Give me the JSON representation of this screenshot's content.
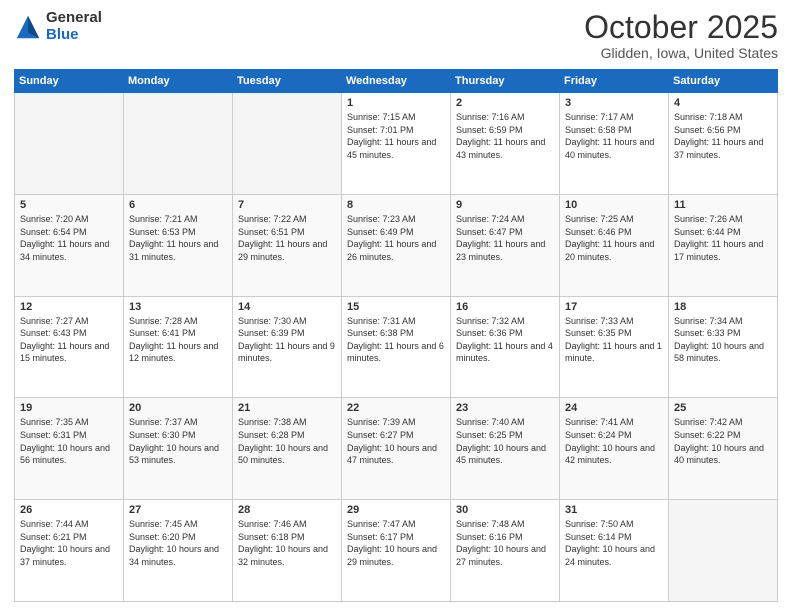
{
  "logo": {
    "general": "General",
    "blue": "Blue"
  },
  "title": "October 2025",
  "subtitle": "Glidden, Iowa, United States",
  "days_of_week": [
    "Sunday",
    "Monday",
    "Tuesday",
    "Wednesday",
    "Thursday",
    "Friday",
    "Saturday"
  ],
  "weeks": [
    [
      {
        "day": "",
        "empty": true
      },
      {
        "day": "",
        "empty": true
      },
      {
        "day": "",
        "empty": true
      },
      {
        "day": "1",
        "sunrise": "7:15 AM",
        "sunset": "7:01 PM",
        "daylight": "11 hours and 45 minutes."
      },
      {
        "day": "2",
        "sunrise": "7:16 AM",
        "sunset": "6:59 PM",
        "daylight": "11 hours and 43 minutes."
      },
      {
        "day": "3",
        "sunrise": "7:17 AM",
        "sunset": "6:58 PM",
        "daylight": "11 hours and 40 minutes."
      },
      {
        "day": "4",
        "sunrise": "7:18 AM",
        "sunset": "6:56 PM",
        "daylight": "11 hours and 37 minutes."
      }
    ],
    [
      {
        "day": "5",
        "sunrise": "7:20 AM",
        "sunset": "6:54 PM",
        "daylight": "11 hours and 34 minutes."
      },
      {
        "day": "6",
        "sunrise": "7:21 AM",
        "sunset": "6:53 PM",
        "daylight": "11 hours and 31 minutes."
      },
      {
        "day": "7",
        "sunrise": "7:22 AM",
        "sunset": "6:51 PM",
        "daylight": "11 hours and 29 minutes."
      },
      {
        "day": "8",
        "sunrise": "7:23 AM",
        "sunset": "6:49 PM",
        "daylight": "11 hours and 26 minutes."
      },
      {
        "day": "9",
        "sunrise": "7:24 AM",
        "sunset": "6:47 PM",
        "daylight": "11 hours and 23 minutes."
      },
      {
        "day": "10",
        "sunrise": "7:25 AM",
        "sunset": "6:46 PM",
        "daylight": "11 hours and 20 minutes."
      },
      {
        "day": "11",
        "sunrise": "7:26 AM",
        "sunset": "6:44 PM",
        "daylight": "11 hours and 17 minutes."
      }
    ],
    [
      {
        "day": "12",
        "sunrise": "7:27 AM",
        "sunset": "6:43 PM",
        "daylight": "11 hours and 15 minutes."
      },
      {
        "day": "13",
        "sunrise": "7:28 AM",
        "sunset": "6:41 PM",
        "daylight": "11 hours and 12 minutes."
      },
      {
        "day": "14",
        "sunrise": "7:30 AM",
        "sunset": "6:39 PM",
        "daylight": "11 hours and 9 minutes."
      },
      {
        "day": "15",
        "sunrise": "7:31 AM",
        "sunset": "6:38 PM",
        "daylight": "11 hours and 6 minutes."
      },
      {
        "day": "16",
        "sunrise": "7:32 AM",
        "sunset": "6:36 PM",
        "daylight": "11 hours and 4 minutes."
      },
      {
        "day": "17",
        "sunrise": "7:33 AM",
        "sunset": "6:35 PM",
        "daylight": "11 hours and 1 minute."
      },
      {
        "day": "18",
        "sunrise": "7:34 AM",
        "sunset": "6:33 PM",
        "daylight": "10 hours and 58 minutes."
      }
    ],
    [
      {
        "day": "19",
        "sunrise": "7:35 AM",
        "sunset": "6:31 PM",
        "daylight": "10 hours and 56 minutes."
      },
      {
        "day": "20",
        "sunrise": "7:37 AM",
        "sunset": "6:30 PM",
        "daylight": "10 hours and 53 minutes."
      },
      {
        "day": "21",
        "sunrise": "7:38 AM",
        "sunset": "6:28 PM",
        "daylight": "10 hours and 50 minutes."
      },
      {
        "day": "22",
        "sunrise": "7:39 AM",
        "sunset": "6:27 PM",
        "daylight": "10 hours and 47 minutes."
      },
      {
        "day": "23",
        "sunrise": "7:40 AM",
        "sunset": "6:25 PM",
        "daylight": "10 hours and 45 minutes."
      },
      {
        "day": "24",
        "sunrise": "7:41 AM",
        "sunset": "6:24 PM",
        "daylight": "10 hours and 42 minutes."
      },
      {
        "day": "25",
        "sunrise": "7:42 AM",
        "sunset": "6:22 PM",
        "daylight": "10 hours and 40 minutes."
      }
    ],
    [
      {
        "day": "26",
        "sunrise": "7:44 AM",
        "sunset": "6:21 PM",
        "daylight": "10 hours and 37 minutes."
      },
      {
        "day": "27",
        "sunrise": "7:45 AM",
        "sunset": "6:20 PM",
        "daylight": "10 hours and 34 minutes."
      },
      {
        "day": "28",
        "sunrise": "7:46 AM",
        "sunset": "6:18 PM",
        "daylight": "10 hours and 32 minutes."
      },
      {
        "day": "29",
        "sunrise": "7:47 AM",
        "sunset": "6:17 PM",
        "daylight": "10 hours and 29 minutes."
      },
      {
        "day": "30",
        "sunrise": "7:48 AM",
        "sunset": "6:16 PM",
        "daylight": "10 hours and 27 minutes."
      },
      {
        "day": "31",
        "sunrise": "7:50 AM",
        "sunset": "6:14 PM",
        "daylight": "10 hours and 24 minutes."
      },
      {
        "day": "",
        "empty": true
      }
    ]
  ]
}
